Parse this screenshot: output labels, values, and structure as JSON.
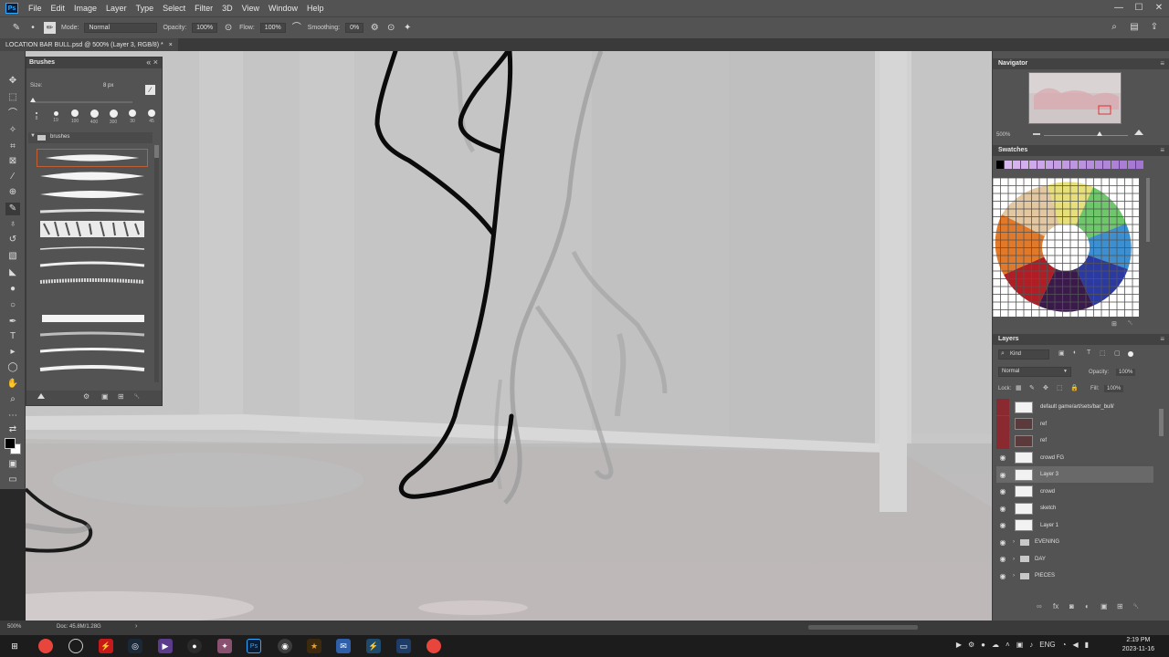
{
  "app": {
    "logo": "Ps",
    "menu": [
      "File",
      "Edit",
      "Image",
      "Layer",
      "Type",
      "Select",
      "Filter",
      "3D",
      "View",
      "Window",
      "Help"
    ],
    "window_controls": [
      "—",
      "☐",
      "✕"
    ]
  },
  "options_bar": {
    "mode_label": "Mode:",
    "mode_value": "Normal",
    "opacity_label": "Opacity:",
    "opacity_value": "100%",
    "flow_label": "Flow:",
    "flow_value": "100%",
    "smoothing_label": "Smoothing:",
    "smoothing_value": "0%"
  },
  "document": {
    "tab_title": "LOCATION BAR BULL.psd @ 500% (Layer 3, RGB/8) *",
    "tab_close": "×"
  },
  "brushes_panel": {
    "title": "Brushes",
    "size_label": "Size:",
    "size_value": "8 px",
    "folder_label": "brushes",
    "tips": [
      {
        "label": "8",
        "size": 2
      },
      {
        "label": "19",
        "size": 5
      },
      {
        "label": "100",
        "size": 8
      },
      {
        "label": "400",
        "size": 9
      },
      {
        "label": "300",
        "size": 9
      },
      {
        "label": "30",
        "size": 8
      },
      {
        "label": "45",
        "size": 8
      }
    ]
  },
  "navigator": {
    "title": "Navigator",
    "zoom": "500%"
  },
  "swatches": {
    "title": "Swatches",
    "top_row_colors": [
      "#000000",
      "#d9b8f0",
      "#d6b3ee",
      "#d3afec",
      "#cfaaea",
      "#ccA6e8",
      "#c8a2e6",
      "#c59de4",
      "#c19ae2",
      "#be96e0",
      "#ba92de",
      "#b78edc",
      "#b38ada",
      "#b086d8",
      "#ad82d6",
      "#a97ed4",
      "#a67ad2",
      "#a276d0"
    ]
  },
  "layers": {
    "title": "Layers",
    "filter_label": "Kind",
    "blend_mode": "Normal",
    "opacity_label": "Opacity:",
    "opacity_value": "100%",
    "lock_label": "Lock:",
    "fill_label": "Fill:",
    "fill_value": "100%",
    "items": [
      {
        "name": "default game/art/sets/bar_bull/",
        "visible": false,
        "flag": "red",
        "thumb": "white"
      },
      {
        "name": "ref",
        "visible": false,
        "flag": "red",
        "thumb": "image"
      },
      {
        "name": "ref",
        "visible": false,
        "flag": "red",
        "thumb": "image"
      },
      {
        "name": "crowd FG",
        "visible": true,
        "flag": "",
        "thumb": "white"
      },
      {
        "name": "Layer 3",
        "visible": true,
        "flag": "",
        "thumb": "white",
        "selected": true
      },
      {
        "name": "crowd",
        "visible": true,
        "flag": "",
        "thumb": "white"
      },
      {
        "name": "sketch",
        "visible": true,
        "flag": "",
        "thumb": "white"
      },
      {
        "name": "Layer 1",
        "visible": true,
        "flag": "",
        "thumb": "white"
      },
      {
        "name": "EVENING",
        "visible": true,
        "flag": "",
        "group": true
      },
      {
        "name": "DAY",
        "visible": true,
        "flag": "",
        "group": true
      },
      {
        "name": "PIECES",
        "visible": true,
        "flag": "",
        "group": true
      }
    ]
  },
  "status": {
    "zoom": "500%",
    "doc_size": "Doc: 45.8M/1.28G",
    "arrow": "›"
  },
  "taskbar": {
    "language": "ENG",
    "time": "2:19 PM",
    "date": "2023-11-16",
    "colors": {
      "chrome": "#e8453c",
      "photoshop": "#31a8ff",
      "background": "#1c1c1c"
    }
  }
}
